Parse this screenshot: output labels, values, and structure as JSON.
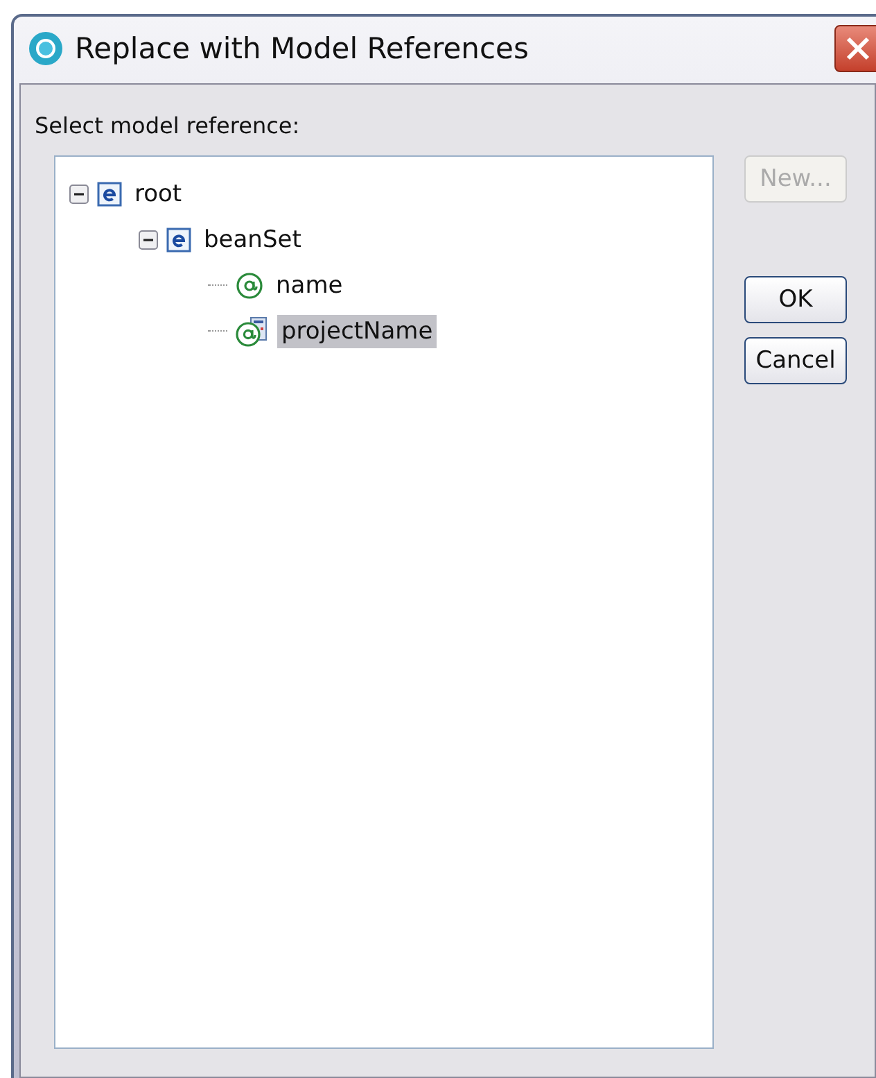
{
  "window": {
    "title": "Replace with Model References"
  },
  "prompt": "Select model reference:",
  "tree": [
    {
      "label": "root",
      "kind": "element",
      "expanded": true,
      "selected": false,
      "children": [
        {
          "label": "beanSet",
          "kind": "element",
          "expanded": true,
          "selected": false,
          "children": [
            {
              "label": "name",
              "kind": "attribute",
              "selected": false
            },
            {
              "label": "projectName",
              "kind": "attribute-ref",
              "selected": true
            }
          ]
        }
      ]
    }
  ],
  "side_buttons": [
    {
      "label": "New...",
      "disabled": true
    }
  ],
  "buttons": [
    {
      "label": "OK",
      "disabled": false
    },
    {
      "label": "Cancel",
      "disabled": false
    }
  ]
}
